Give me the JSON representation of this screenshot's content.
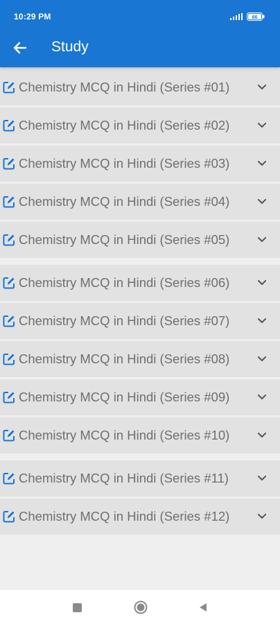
{
  "status_bar": {
    "time": "10:29 PM",
    "battery": "66"
  },
  "app_bar": {
    "title": "Study"
  },
  "groups": [
    {
      "items": [
        {
          "label": "Chemistry MCQ in Hindi (Series #01)"
        },
        {
          "label": "Chemistry MCQ in Hindi (Series #02)"
        },
        {
          "label": "Chemistry MCQ in Hindi (Series #03)"
        },
        {
          "label": "Chemistry MCQ in Hindi (Series #04)"
        },
        {
          "label": "Chemistry MCQ in Hindi (Series #05)"
        }
      ]
    },
    {
      "items": [
        {
          "label": "Chemistry MCQ in Hindi (Series #06)"
        },
        {
          "label": "Chemistry MCQ in Hindi (Series #07)"
        },
        {
          "label": "Chemistry MCQ in Hindi (Series #08)"
        },
        {
          "label": "Chemistry MCQ in Hindi (Series #09)"
        },
        {
          "label": "Chemistry MCQ in Hindi (Series #10)"
        }
      ]
    },
    {
      "items": [
        {
          "label": "Chemistry MCQ in Hindi (Series #11)"
        },
        {
          "label": "Chemistry MCQ in Hindi (Series #12)"
        }
      ]
    }
  ],
  "icons": {
    "row_icon": "edit-icon",
    "expand_icon": "chevron-down-icon",
    "back_icon": "back-arrow-icon"
  },
  "colors": {
    "primary": "#1976d2",
    "row_background": "#e2e2e2",
    "row_text": "#6f6f6f",
    "page_background": "#efefef"
  }
}
